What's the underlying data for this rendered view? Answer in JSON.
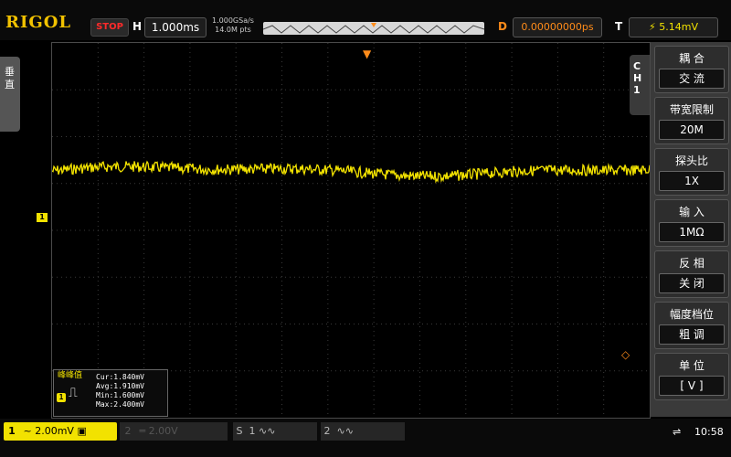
{
  "header": {
    "brand": "RIGOL",
    "run_state": "STOP",
    "timebase_label": "H",
    "timebase_value": "1.000ms",
    "sample_rate": "1.000GSa/s",
    "memory_depth": "14.0M pts",
    "delay_label": "D",
    "delay_value": "0.00000000ps",
    "trigger_label": "T",
    "trigger_value": "5.14mV"
  },
  "left_panel": {
    "label": "垂直"
  },
  "channel": {
    "marker": "1",
    "tab_label": "CH1"
  },
  "measurement": {
    "title": "峰峰值",
    "badge": "1",
    "cur": "Cur:1.840mV",
    "avg": "Avg:1.910mV",
    "min": "Min:1.600mV",
    "max": "Max:2.400mV"
  },
  "menu": [
    {
      "title": "耦 合",
      "value": "交 流"
    },
    {
      "title": "带宽限制",
      "value": "20M"
    },
    {
      "title": "探头比",
      "value": "1X"
    },
    {
      "title": "输 入",
      "value": "1MΩ"
    },
    {
      "title": "反 相",
      "value": "关 闭"
    },
    {
      "title": "幅度档位",
      "value": "粗 调"
    },
    {
      "title": "单 位",
      "value": "[ V ]"
    }
  ],
  "bottom": {
    "ch1_index": "1",
    "ch1_scale": "~ 2.00mV",
    "ch2_index": "2",
    "ch2_scale": "2.00V",
    "math_label": "S",
    "math_index": "1",
    "ref_index": "2",
    "clock": "10:58"
  },
  "colors": {
    "ch1": "#f2e200",
    "trigger": "#ff8c1a",
    "stop": "#ff2a2a"
  },
  "icons": {
    "usb": "usb-icon",
    "trigger_edge": "trigger-edge-icon",
    "sine": "sine-wave-icon"
  }
}
